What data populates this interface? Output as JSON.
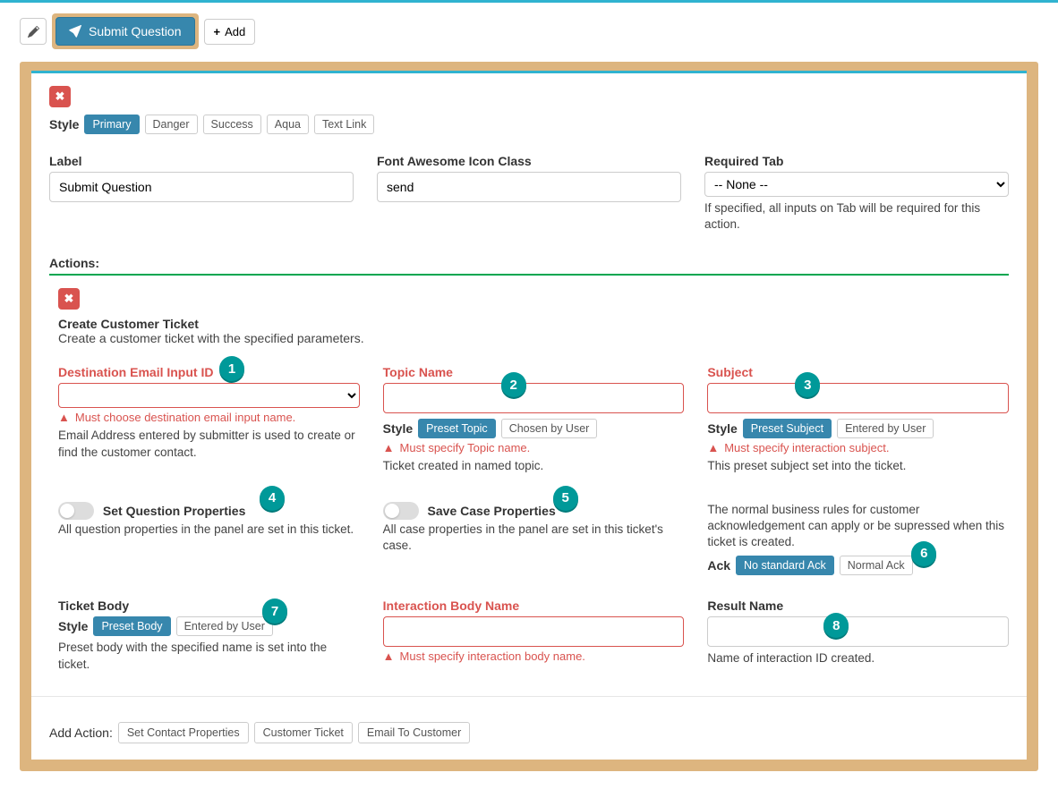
{
  "header": {
    "submit_label": "Submit Question",
    "add_label": "Add"
  },
  "style": {
    "label": "Style",
    "options": [
      "Primary",
      "Danger",
      "Success",
      "Aqua",
      "Text Link"
    ],
    "active": "Primary"
  },
  "label_field": {
    "label": "Label",
    "value": "Submit Question"
  },
  "icon_field": {
    "label": "Font Awesome Icon Class",
    "value": "send"
  },
  "required_tab": {
    "label": "Required Tab",
    "value": "-- None --",
    "help": "If specified, all inputs on Tab will be required for this action."
  },
  "actions_label": "Actions:",
  "action": {
    "title": "Create Customer Ticket",
    "subtitle": "Create a customer ticket with the specified parameters.",
    "dest_email": {
      "label": "Destination Email Input ID",
      "error": "Must choose destination email input name.",
      "help": "Email Address entered by submitter is used to create or find the customer contact."
    },
    "topic": {
      "label": "Topic Name",
      "style_label": "Style",
      "pills": [
        "Preset Topic",
        "Chosen by User"
      ],
      "active": "Preset Topic",
      "error": "Must specify Topic name.",
      "help": "Ticket created in named topic."
    },
    "subject": {
      "label": "Subject",
      "style_label": "Style",
      "pills": [
        "Preset Subject",
        "Entered by User"
      ],
      "active": "Preset Subject",
      "error": "Must specify interaction subject.",
      "help": "This preset subject set into the ticket."
    },
    "set_q": {
      "label": "Set Question Properties",
      "help": "All question properties in the panel are set in this ticket."
    },
    "save_case": {
      "label": "Save Case Properties",
      "help": "All case properties in the panel are set in this ticket's case."
    },
    "ack": {
      "help": "The normal business rules for customer acknowledgement can apply or be supressed when this ticket is created.",
      "label": "Ack",
      "pills": [
        "No standard Ack",
        "Normal Ack"
      ],
      "active": "No standard Ack"
    },
    "ticket_body": {
      "label": "Ticket Body",
      "style_label": "Style",
      "pills": [
        "Preset Body",
        "Entered by User"
      ],
      "active": "Preset Body",
      "help": "Preset body with the specified name is set into the ticket."
    },
    "interaction_body": {
      "label": "Interaction Body Name",
      "error": "Must specify interaction body name."
    },
    "result": {
      "label": "Result Name",
      "help": "Name of interaction ID created."
    }
  },
  "add_action": {
    "label": "Add Action:",
    "options": [
      "Set Contact Properties",
      "Customer Ticket",
      "Email To Customer"
    ]
  },
  "badges": [
    "1",
    "2",
    "3",
    "4",
    "5",
    "6",
    "7",
    "8"
  ]
}
